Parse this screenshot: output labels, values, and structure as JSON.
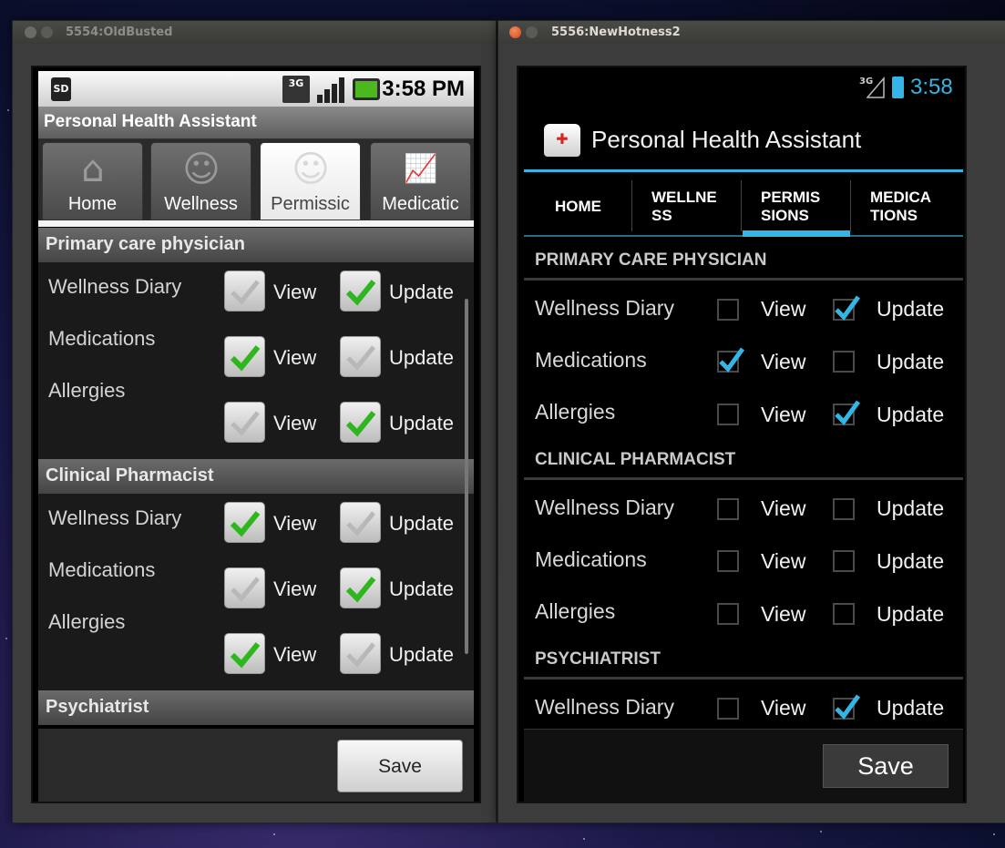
{
  "old_window": {
    "title": "5554:OldBusted",
    "status": {
      "network": "3G",
      "sd": "SD",
      "time": "3:58 PM"
    },
    "app_title": "Personal Health Assistant",
    "tabs": [
      {
        "label": "Home",
        "icon": "home-icon",
        "selected": false
      },
      {
        "label": "Wellness",
        "icon": "smiley-icon",
        "selected": false
      },
      {
        "label": "Permissic",
        "icon": "smiley-icon",
        "selected": true
      },
      {
        "label": "Medicatic",
        "icon": "chart-icon",
        "selected": false
      }
    ],
    "sections": [
      {
        "header": "Primary care physician",
        "rows": [
          {
            "label": "Wellness Diary",
            "view": false,
            "update": true
          },
          {
            "label": "Medications",
            "view": true,
            "update": false
          },
          {
            "label": "Allergies",
            "view": false,
            "update": true
          }
        ]
      },
      {
        "header": "Clinical Pharmacist",
        "rows": [
          {
            "label": "Wellness Diary",
            "view": true,
            "update": false
          },
          {
            "label": "Medications",
            "view": false,
            "update": true
          },
          {
            "label": "Allergies",
            "view": true,
            "update": false
          }
        ]
      },
      {
        "header": "Psychiatrist",
        "rows": []
      }
    ],
    "view_label": "View",
    "update_label": "Update",
    "save_label": "Save"
  },
  "new_window": {
    "title": "5556:NewHotness2",
    "status": {
      "network": "3G",
      "time": "3:58"
    },
    "app_title": "Personal Health Assistant",
    "tabs": [
      {
        "line1": "HOME",
        "line2": "",
        "selected": false
      },
      {
        "line1": "WELLNE",
        "line2": "SS",
        "selected": false
      },
      {
        "line1": "PERMIS",
        "line2": "SIONS",
        "selected": true
      },
      {
        "line1": "MEDICA",
        "line2": "TIONS",
        "selected": false
      }
    ],
    "sections": [
      {
        "header": "PRIMARY CARE PHYSICIAN",
        "rows": [
          {
            "label": "Wellness Diary",
            "view": false,
            "update": true
          },
          {
            "label": "Medications",
            "view": true,
            "update": false
          },
          {
            "label": "Allergies",
            "view": false,
            "update": true
          }
        ]
      },
      {
        "header": "CLINICAL PHARMACIST",
        "rows": [
          {
            "label": "Wellness Diary",
            "view": false,
            "update": false
          },
          {
            "label": "Medications",
            "view": false,
            "update": false
          },
          {
            "label": "Allergies",
            "view": false,
            "update": false
          }
        ]
      },
      {
        "header": "PSYCHIATRIST",
        "rows": [
          {
            "label": "Wellness Diary",
            "view": false,
            "update": true
          }
        ]
      }
    ],
    "view_label": "View",
    "update_label": "Update",
    "save_label": "Save"
  },
  "colors": {
    "holo_blue": "#33b5e5",
    "old_check_green": "#2fb51d"
  }
}
